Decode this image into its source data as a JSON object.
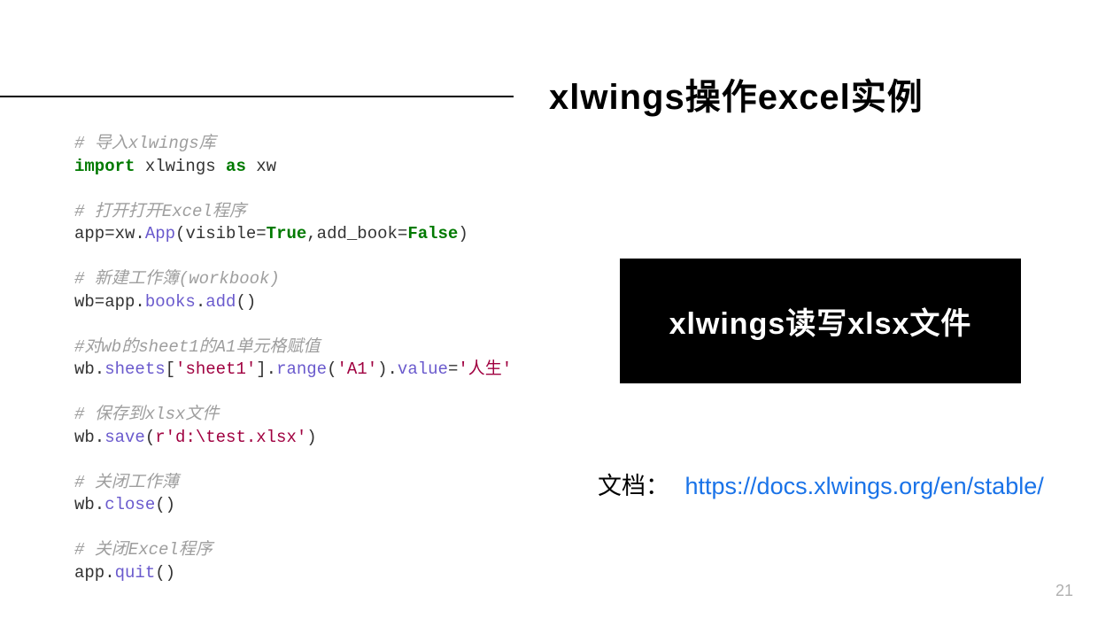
{
  "title": "xlwings操作excel实例",
  "code": {
    "c1": "# 导入xlwings库",
    "kw_import": "import",
    "mod": " xlwings ",
    "kw_as": "as",
    "alias": " xw",
    "c2": "# 打开打开Excel程序",
    "l2a": "app=xw.",
    "l2_app": "App",
    "l2b": "(visible=",
    "true": "True",
    "l2c": ",add_book=",
    "false": "False",
    "l2d": ")",
    "c3": "# 新建工作簿(workbook)",
    "l3a": "wb=app.",
    "l3_books": "books",
    "l3b": ".",
    "l3_add": "add",
    "l3c": "()",
    "c4": "#对wb的sheet1的A1单元格赋值",
    "l4a": "wb.",
    "l4_sheets": "sheets",
    "l4b": "[",
    "s_sheet1": "'sheet1'",
    "l4c": "].",
    "l4_range": "range",
    "l4d": "(",
    "s_a1": "'A1'",
    "l4e": ").",
    "l4_value": "value",
    "l4f": "=",
    "s_life": "'人生'",
    "c5": "# 保存到xlsx文件",
    "l5a": "wb.",
    "l5_save": "save",
    "l5b": "(",
    "s_path": "r'd:\\test.xlsx'",
    "l5c": ")",
    "c6": "# 关闭工作薄",
    "l6a": "wb.",
    "l6_close": "close",
    "l6b": "()",
    "c7": "# 关闭Excel程序",
    "l7a": "app.",
    "l7_quit": "quit",
    "l7b": "()"
  },
  "box_label": "xlwings读写xlsx文件",
  "doc_label": "文档：",
  "doc_url": "https://docs.xlwings.org/en/stable/",
  "page_number": "21"
}
